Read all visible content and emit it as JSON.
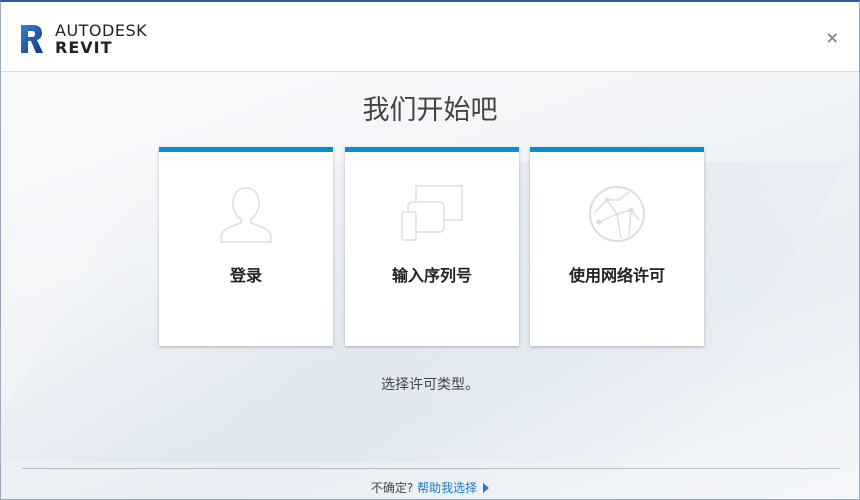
{
  "header": {
    "brand_line1": "AUTODESK",
    "brand_line2": "REVIT",
    "close_label": "×"
  },
  "title": "我们开始吧",
  "cards": [
    {
      "label": "登录",
      "icon": "user-icon"
    },
    {
      "label": "输入序列号",
      "icon": "devices-icon"
    },
    {
      "label": "使用网络许可",
      "icon": "network-globe-icon"
    }
  ],
  "hint": "选择许可类型。",
  "footer": {
    "question": "不确定?",
    "link": "帮助我选择"
  },
  "colors": {
    "accent": "#0a8dd0",
    "link": "#1a7cc0",
    "top_border": "#2d5a9a"
  }
}
